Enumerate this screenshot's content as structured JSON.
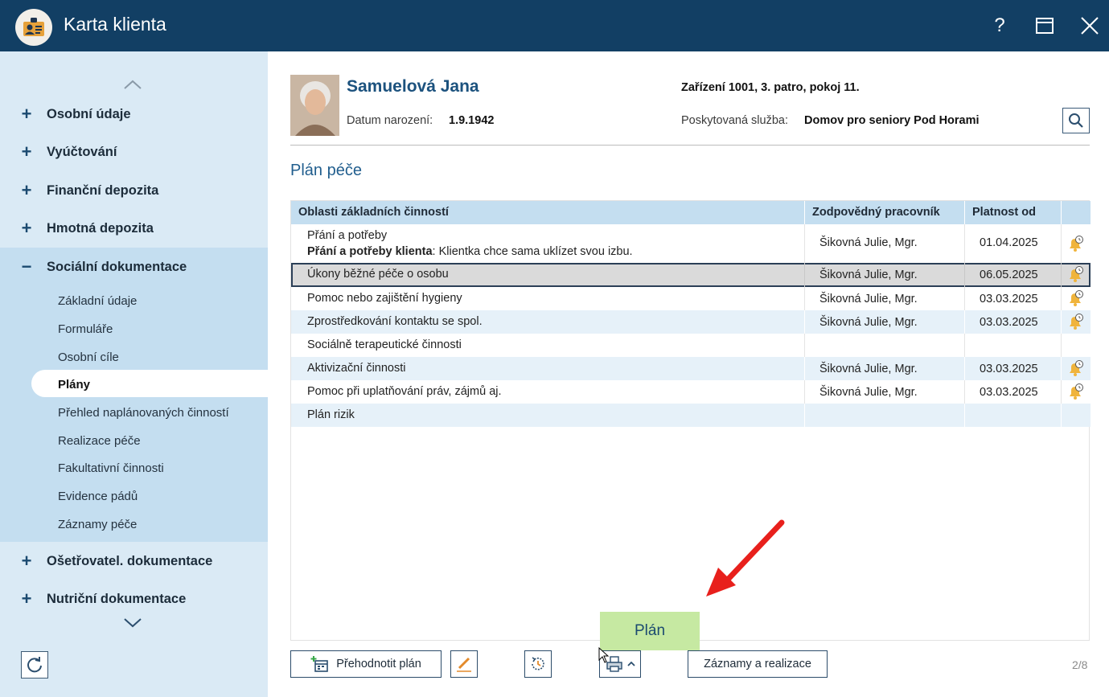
{
  "window": {
    "title": "Karta klienta",
    "help_label": "?"
  },
  "sidebar": {
    "groups": [
      {
        "label": "Osobní údaje",
        "sign": "+"
      },
      {
        "label": "Vyúčtování",
        "sign": "+"
      },
      {
        "label": "Finanční depozita",
        "sign": "+"
      },
      {
        "label": "Hmotná depozita",
        "sign": "+"
      },
      {
        "label": "Sociální dokumentace",
        "sign": "−"
      },
      {
        "label": "Ošetřovatel. dokumentace",
        "sign": "+"
      },
      {
        "label": "Nutriční dokumentace",
        "sign": "+"
      }
    ],
    "subitems": [
      {
        "label": "Základní údaje"
      },
      {
        "label": "Formuláře"
      },
      {
        "label": "Osobní cíle"
      },
      {
        "label": "Plány",
        "active": true
      },
      {
        "label": "Přehled naplánovaných činností"
      },
      {
        "label": "Realizace péče"
      },
      {
        "label": "Fakultativní činnosti"
      },
      {
        "label": "Evidence pádů"
      },
      {
        "label": "Záznamy péče"
      }
    ]
  },
  "client": {
    "name": "Samuelová Jana",
    "birth_label": "Datum narození:",
    "birth_value": "1.9.1942",
    "facility": "Zařízení 1001, 3. patro, pokoj 11.",
    "service_label": "Poskytovaná služba:",
    "service_value": "Domov pro seniory Pod Horami"
  },
  "section_title": "Plán péče",
  "table": {
    "columns": [
      "Oblasti základních činností",
      "Zodpovědný pracovník",
      "Platnost od"
    ],
    "rows": [
      {
        "area": "Přání a potřeby",
        "note_bold": "Přání a potřeby klienta",
        "note_rest": ": Klientka chce sama uklízet svou izbu.",
        "worker": "Šikovná Julie, Mgr.",
        "date": "01.04.2025",
        "bell": true
      },
      {
        "area": "Úkony běžné péče o osobu",
        "worker": "Šikovná Julie, Mgr.",
        "date": "06.05.2025",
        "bell": true,
        "selected": true
      },
      {
        "area": "Pomoc nebo zajištění hygieny",
        "worker": "Šikovná Julie, Mgr.",
        "date": "03.03.2025",
        "bell": true
      },
      {
        "area": "Zprostředkování kontaktu se spol.",
        "worker": "Šikovná Julie, Mgr.",
        "date": "03.03.2025",
        "bell": true
      },
      {
        "area": "Sociálně terapeutické činnosti",
        "worker": "",
        "date": "",
        "bell": false
      },
      {
        "area": "Aktivizační činnosti",
        "worker": "Šikovná Julie, Mgr.",
        "date": "03.03.2025",
        "bell": true
      },
      {
        "area": "Pomoc při uplatňování práv, zájmů aj.",
        "worker": "Šikovná Julie, Mgr.",
        "date": "03.03.2025",
        "bell": true
      },
      {
        "area": "Plán rizik",
        "worker": "",
        "date": "",
        "bell": false
      }
    ]
  },
  "toolbar": {
    "reevaluate_label": "Přehodnotit plán",
    "records_label": "Záznamy a realizace",
    "tooltip_label": "Plán",
    "pager": "2/8"
  },
  "colors": {
    "titlebar": "#123f64",
    "sidebar": "#daeaf5",
    "sidebar_group": "#c4def0",
    "header_row": "#c4def0",
    "accent_text": "#1c527e",
    "tooltip": "#c6e9a2",
    "annotation_arrow": "#e8201c"
  }
}
